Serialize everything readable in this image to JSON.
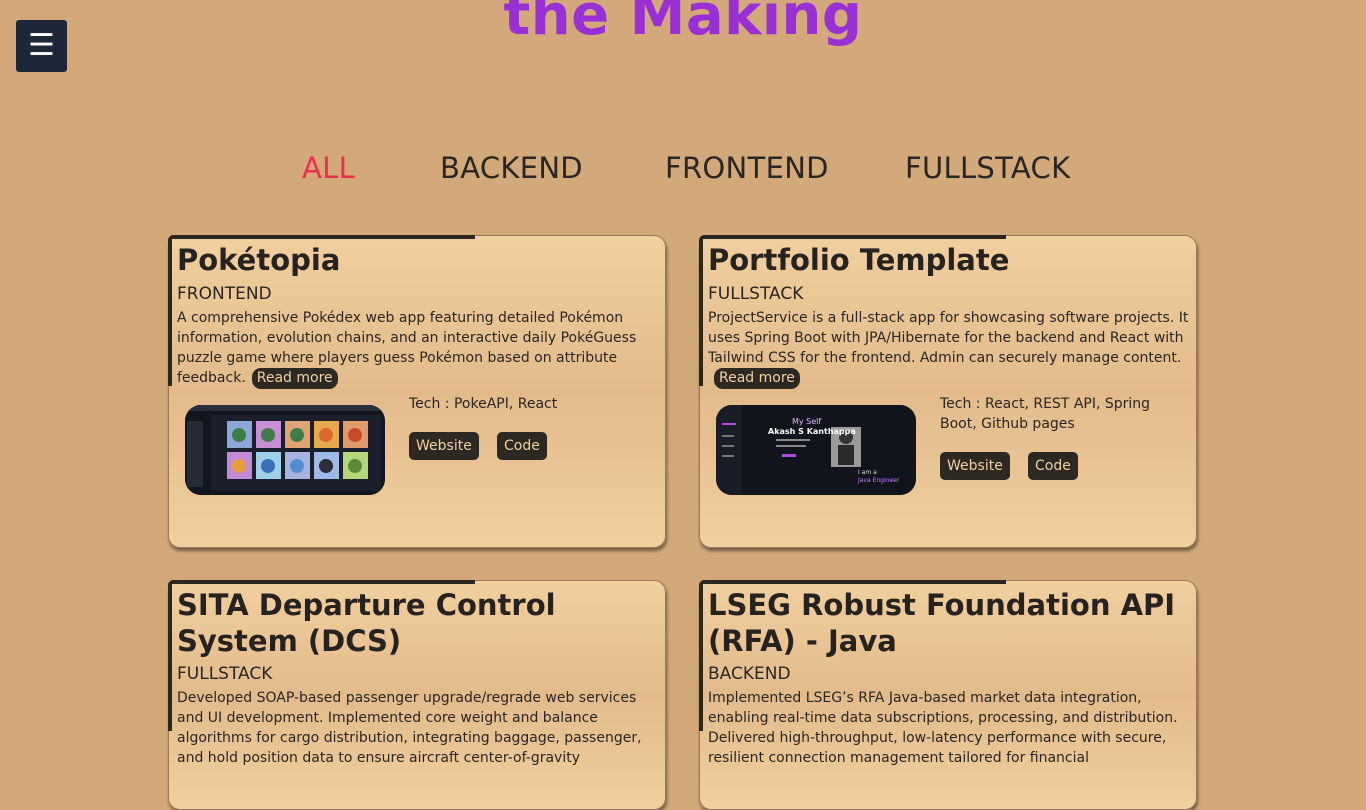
{
  "header": {
    "menu_icon": "☰",
    "hero_title": "the Making"
  },
  "filters": {
    "items": [
      {
        "label": "ALL"
      },
      {
        "label": "BACKEND"
      },
      {
        "label": "FRONTEND"
      },
      {
        "label": "FULLSTACK"
      }
    ]
  },
  "projects": [
    {
      "title": "Pokétopia",
      "category": "FRONTEND",
      "description": "A comprehensive Pokédex web app featuring detailed Pokémon information, evolution chains, and an interactive daily PokéGuess puzzle game where players guess Pokémon based on attribute feedback.",
      "read_more": "Read more",
      "tech": "Tech : PokeAPI, React",
      "website_label": "Website",
      "code_label": "Code"
    },
    {
      "title": "Portfolio Template",
      "category": "FULLSTACK",
      "description": "ProjectService is a full-stack app for showcasing software projects. It uses Spring Boot with JPA/Hibernate for the backend and React with Tailwind CSS for the frontend. Admin can securely manage content.",
      "read_more": "Read more",
      "tech": "Tech : React, REST API, Spring Boot, Github pages",
      "website_label": "Website",
      "code_label": "Code",
      "preview": {
        "line1": "My Self",
        "line2": "Akash S Kanthappa",
        "line3": "I am a",
        "line4": "Java Engineer"
      }
    },
    {
      "title": "SITA Departure Control System (DCS)",
      "category": "FULLSTACK",
      "description": "Developed SOAP-based passenger upgrade/regrade web services and UI development. Implemented core weight and balance algorithms for cargo distribution, integrating baggage, passenger, and hold position data to ensure aircraft center-of-gravity"
    },
    {
      "title": "LSEG Robust Foundation API (RFA) - Java",
      "category": "BACKEND",
      "description": "Implemented LSEG’s RFA Java-based market data integration, enabling real-time data subscriptions, processing, and distribution. Delivered high-throughput, low-latency performance with secure, resilient connection management tailored for financial"
    }
  ],
  "colors": {
    "background": "#d3a87b",
    "hero_title": "#9b2fd6",
    "active_filter": "#ef2d4f",
    "button_bg": "#2d2822",
    "menu_button_bg": "#1d2739"
  }
}
